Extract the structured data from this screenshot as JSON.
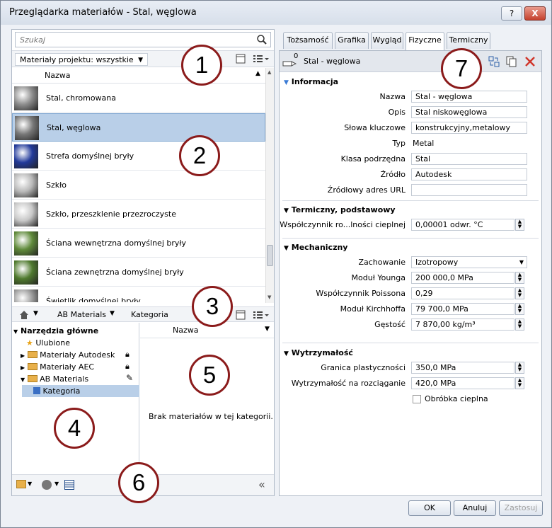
{
  "window": {
    "title": "Przeglądarka materiałów - Stal, węglowa",
    "help_label": "?",
    "close_label": "X"
  },
  "search": {
    "placeholder": "Szukaj"
  },
  "library_filter": {
    "label": "Materiały projektu: wszystkie"
  },
  "list": {
    "column": "Nazwa",
    "items": [
      {
        "label": "Stal, chromowana",
        "thumb_color": "#8c8c8c"
      },
      {
        "label": "Stal, węglowa",
        "thumb_color": "#777777"
      },
      {
        "label": "Strefa domyślnej bryły",
        "thumb_color": "#223a9a"
      },
      {
        "label": "Szkło",
        "thumb_color": "#b8b8b8"
      },
      {
        "label": "Szkło, przeszklenie przezroczyste",
        "thumb_color": "#c8c8c8"
      },
      {
        "label": "Ściana wewnętrzna domyślnej bryły",
        "thumb_color": "#5f8a3a"
      },
      {
        "label": "Ściana zewnętrzna domyślnej bryły",
        "thumb_color": "#4f7a2e"
      },
      {
        "label": "Świetlik domyślnej bryły",
        "thumb_color": "#9a9a9a"
      }
    ],
    "selected_index": 1
  },
  "lower_breadcrumb": {
    "part1": "AB Materials",
    "part2": "Kategoria"
  },
  "tree": {
    "root": "Narzędzia główne",
    "items": [
      "Ulubione",
      "Materiały Autodesk",
      "Materiały AEC",
      "AB Materials",
      "Kategoria"
    ]
  },
  "category_panel": {
    "column": "Nazwa",
    "empty": "Brak materiałów w tej kategorii."
  },
  "tabs": [
    "Tożsamość",
    "Grafika",
    "Wygląd",
    "Fizyczne",
    "Termiczny"
  ],
  "active_tab": "Fizyczne",
  "asset": {
    "name": "Stal - węglowa",
    "count": "0"
  },
  "info": {
    "section": "Informacja",
    "name_label": "Nazwa",
    "name_value": "Stal - węglowa",
    "desc_label": "Opis",
    "desc_value": "Stal niskowęglowa",
    "keywords_label": "Słowa kluczowe",
    "keywords_value": "konstrukcyjny,metalowy",
    "type_label": "Typ",
    "type_value": "Metal",
    "subclass_label": "Klasa podrzędna",
    "subclass_value": "Stal",
    "source_label": "Źródło",
    "source_value": "Autodesk",
    "url_label": "Źródłowy adres URL",
    "url_value": ""
  },
  "thermal": {
    "section": "Termiczny, podstawowy",
    "coef_label": "Współczynnik ro...lności cieplnej",
    "coef_value": "0,00001 odwr. °C"
  },
  "mechanical": {
    "section": "Mechaniczny",
    "behavior_label": "Zachowanie",
    "behavior_value": "Izotropowy",
    "young_label": "Moduł Younga",
    "young_value": "200 000,0 MPa",
    "poisson_label": "Współczynnik Poissona",
    "poisson_value": "0,29",
    "kirchhoff_label": "Moduł Kirchhoffa",
    "kirchhoff_value": "79 700,0 MPa",
    "density_label": "Gęstość",
    "density_value": "7 870,00 kg/m³"
  },
  "strength": {
    "section": "Wytrzymałość",
    "yield_label": "Granica plastyczności",
    "yield_value": "350,0 MPa",
    "tensile_label": "Wytrzymałość na rozciąganie",
    "tensile_value": "420,0 MPa",
    "heat_label": "Obróbka cieplna"
  },
  "buttons": {
    "ok": "OK",
    "cancel": "Anuluj",
    "apply": "Zastosuj"
  },
  "callouts": [
    "1",
    "2",
    "3",
    "4",
    "5",
    "6",
    "7"
  ],
  "colors": {
    "callout_border": "#8b1b1b",
    "selection": "#b9cfe8",
    "delete_red": "#d0362b"
  }
}
